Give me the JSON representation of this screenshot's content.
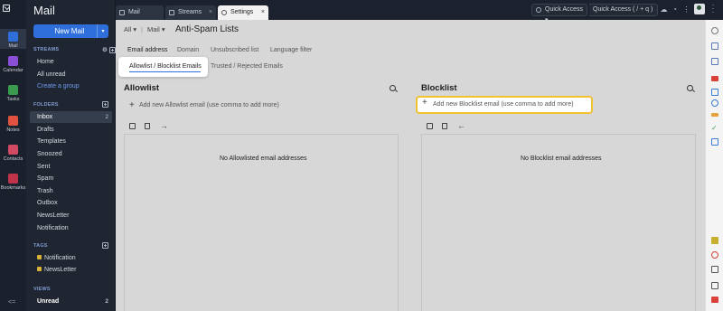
{
  "app": {
    "title": "Mail"
  },
  "rail": {
    "items": [
      {
        "label": "Mail",
        "icon": "mail-icon",
        "color": "#2f6fdb",
        "active": true
      },
      {
        "label": "Calendar",
        "icon": "calendar-icon",
        "color": "#8a4fd6"
      },
      {
        "label": "Tasks",
        "icon": "tasks-icon",
        "color": "#3a9a4e"
      },
      {
        "label": "Notes",
        "icon": "notes-icon",
        "color": "#e0513f"
      },
      {
        "label": "Contacts",
        "icon": "contacts-icon",
        "color": "#d04a63"
      },
      {
        "label": "Bookmarks",
        "icon": "bookmarks-icon",
        "color": "#c1334a"
      }
    ],
    "collapse_glyph": "<="
  },
  "sidebar": {
    "new_mail_label": "New Mail",
    "streams_heading": "STREAMS",
    "streams_items": [
      {
        "label": "Home"
      },
      {
        "label": "All unread"
      },
      {
        "label": "Create a group"
      }
    ],
    "folders_heading": "FOLDERS",
    "folders": [
      {
        "label": "Inbox",
        "count": "2"
      },
      {
        "label": "Drafts"
      },
      {
        "label": "Templates"
      },
      {
        "label": "Snoozed"
      },
      {
        "label": "Sent"
      },
      {
        "label": "Spam"
      },
      {
        "label": "Trash"
      },
      {
        "label": "Outbox"
      },
      {
        "label": "NewsLetter"
      },
      {
        "label": "Notification"
      }
    ],
    "tags_heading": "TAGS",
    "tags": [
      {
        "label": "Notification",
        "color": "#d9b23a"
      },
      {
        "label": "NewsLetter",
        "color": "#d9b23a"
      }
    ],
    "views_heading": "VIEWS",
    "views": [
      {
        "label": "Unread",
        "count": "2"
      }
    ]
  },
  "topbar": {
    "tabs": [
      {
        "label": "Mail",
        "icon": "mail-tab-icon"
      },
      {
        "label": "Streams",
        "icon": "streams-tab-icon"
      },
      {
        "label": "Settings",
        "icon": "settings-tab-icon",
        "active": true
      }
    ],
    "quick_access_label": "Quick Access",
    "quick_access_search": "Quick Access  ( / + q )"
  },
  "main": {
    "breadcrumb_all": "All",
    "breadcrumb_mail": "Mail",
    "page_title": "Anti-Spam Lists",
    "tabs": [
      {
        "label": "Email address",
        "active": true
      },
      {
        "label": "Domain"
      },
      {
        "label": "Unsubscribed list"
      },
      {
        "label": "Language filter"
      }
    ],
    "subtabs": [
      {
        "label": "Allowlist / Blocklist Emails",
        "active": true
      },
      {
        "label": "Trusted / Rejected Emails"
      }
    ],
    "allowlist": {
      "title": "Allowlist",
      "add_placeholder": "Add new Allowlist email (use comma to add more)",
      "empty_message": "No Allowlisted email addresses"
    },
    "blocklist": {
      "title": "Blocklist",
      "add_placeholder": "Add new Blocklist email (use comma to add more)",
      "empty_message": "No Blocklist email addresses"
    }
  },
  "colors": {
    "accent": "#2f6fdb",
    "highlight_border": "#f2c230"
  }
}
